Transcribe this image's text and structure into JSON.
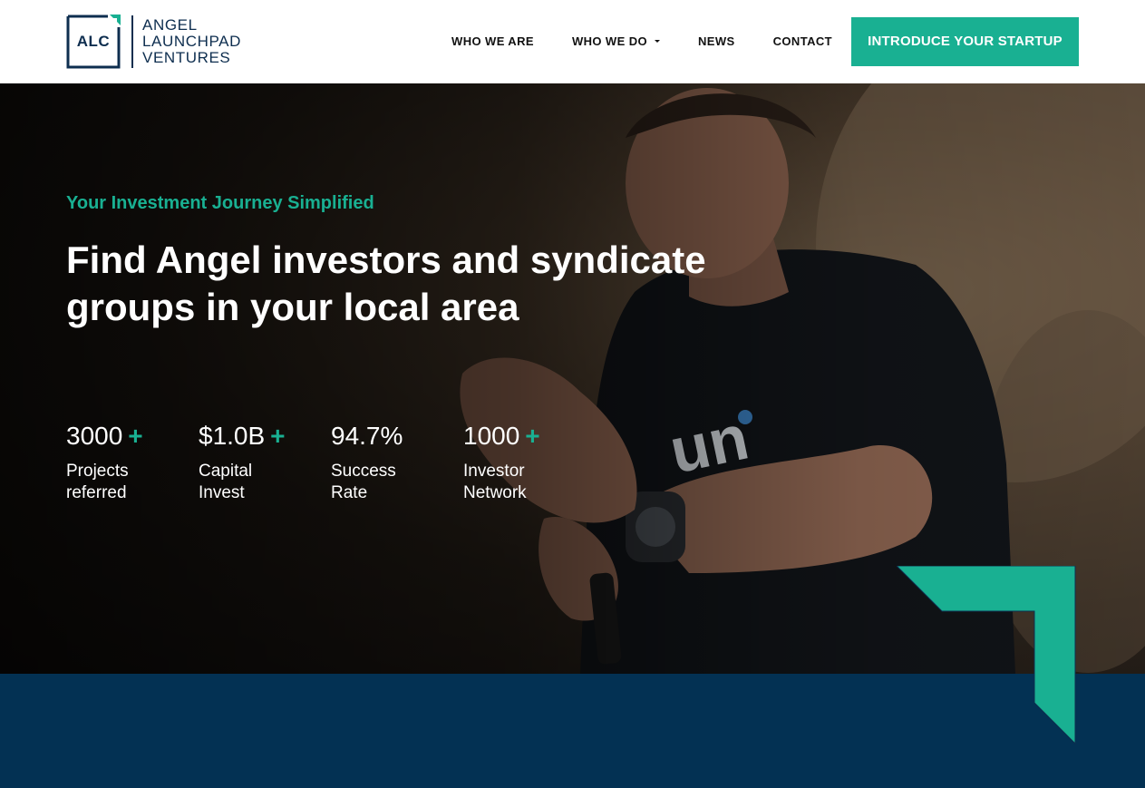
{
  "brand": {
    "abbr": "ALC",
    "name_lines": [
      "ANGEL",
      "LAUNCHPAD",
      "VENTURES"
    ],
    "navy": "#0e2e4f",
    "accent": "#19b092"
  },
  "nav": {
    "items": [
      {
        "label": "WHO WE ARE"
      },
      {
        "label": "WHO WE DO",
        "dropdown": true
      },
      {
        "label": "NEWS"
      },
      {
        "label": "CONTACT"
      }
    ],
    "cta_label": "INTRODUCE YOUR STARTUP"
  },
  "hero": {
    "eyebrow": "Your Investment Journey Simplified",
    "headline": "Find Angel investors and syndicate groups in your local area",
    "stats": [
      {
        "value": "3000",
        "plus": "+",
        "label": "Projects referred"
      },
      {
        "value": "$1.0B",
        "plus": "+",
        "label": "Capital Invest"
      },
      {
        "value": "94.7%",
        "plus": "",
        "label": "Success Rate"
      },
      {
        "value": "1000",
        "plus": "+",
        "label": "Investor Network"
      }
    ]
  },
  "band": {
    "color": "#033153"
  }
}
